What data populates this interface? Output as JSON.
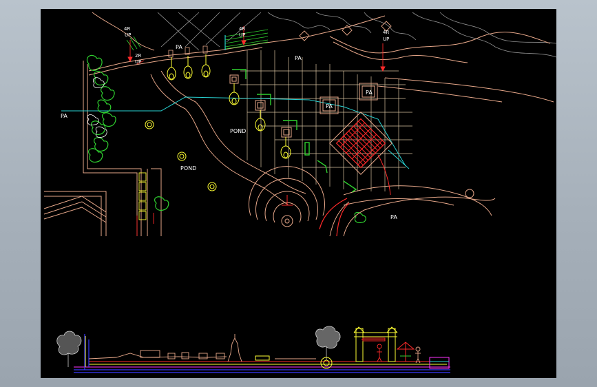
{
  "labels": {
    "pa_left": "PA",
    "pa_top": "PA",
    "pa_box_1": "PA",
    "pa_box_2": "PA",
    "pa_bottom": "PA",
    "pond_1": "POND",
    "pond_2": "POND",
    "stair_1_upper": "4R",
    "stair_1_lower": "UP",
    "stair_2_upper": "2R",
    "stair_2_lower": "UP",
    "stair_3_upper": "4R",
    "stair_3_lower": "UP",
    "stair_4_upper": "4R",
    "stair_4_lower": "UP",
    "plan_pa_mid": "PA"
  },
  "colors": {
    "background": "#000000",
    "boundary": "#e8a88a",
    "grid": "#d9c3a0",
    "cyan": "#29d3d3",
    "green": "#2fd12f",
    "yellow": "#ffff33",
    "red": "#ff2a2a",
    "white": "#ffffff",
    "blue": "#3a3aff",
    "magenta": "#ff33ff"
  }
}
